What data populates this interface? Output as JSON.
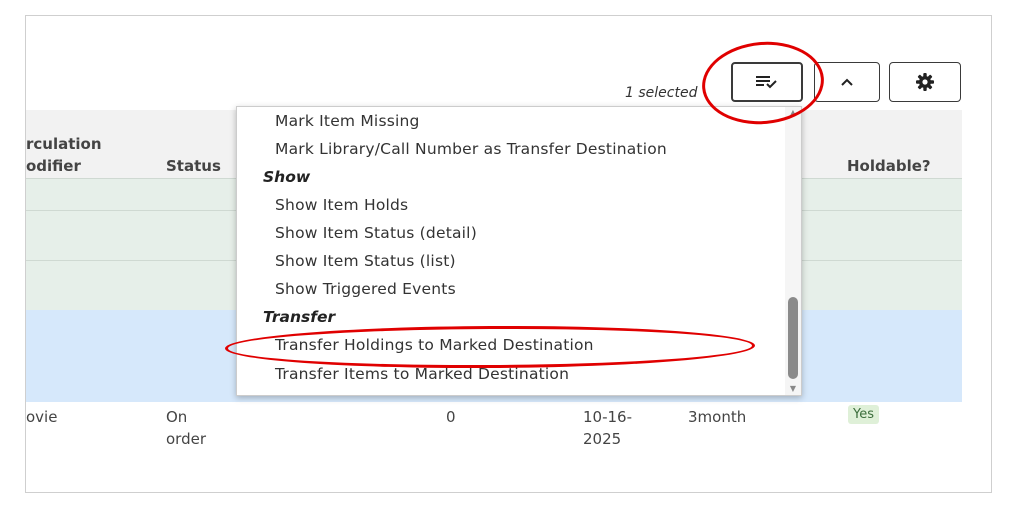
{
  "toolbar": {
    "selected_text": "1 selected",
    "actions_icon": "list-check-icon",
    "collapse_icon": "chevron-up-icon",
    "settings_icon": "gear-icon"
  },
  "table": {
    "headers": [
      "rculation\nodifier",
      "Status",
      "Holdable?"
    ],
    "row": {
      "circ_modifier": "ovie",
      "status": "On order",
      "count": "0",
      "date": "10-16-2025",
      "loan": "3month",
      "holdable": "Yes"
    }
  },
  "menu": {
    "items_top": [
      "Mark Item Missing",
      "Mark Library/Call Number as Transfer Destination"
    ],
    "show_header": "Show",
    "show_items": [
      "Show Item Holds",
      "Show Item Status (detail)",
      "Show Item Status (list)",
      "Show Triggered Events"
    ],
    "transfer_header": "Transfer",
    "transfer_items": [
      "Transfer Holdings to Marked Destination",
      "Transfer Items to Marked Destination"
    ]
  },
  "colors": {
    "highlight_ring": "#e00000",
    "row_green": "#e6efe9",
    "row_blue": "#d6e8fb"
  }
}
